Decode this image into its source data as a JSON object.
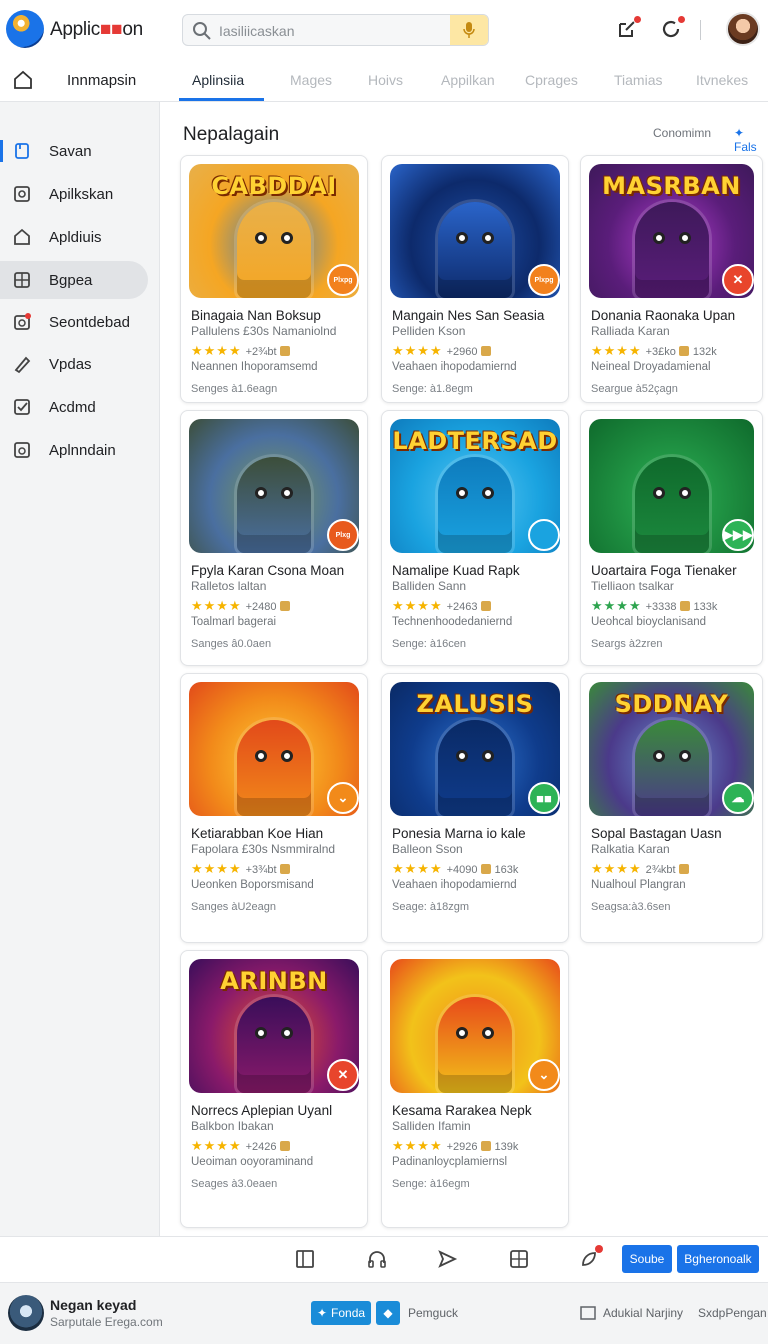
{
  "header": {
    "app_title_pre": "Applic",
    "app_title_red": "■■",
    "app_title_post": "on",
    "search_placeholder": "Iasiliicaskan"
  },
  "tabs": {
    "home_label": "Innmapsin",
    "items": [
      "Aplinsiia",
      "Mages",
      "Hoivs",
      "Appilkan",
      "Cprages",
      "Tiamias",
      "Itvnekes"
    ],
    "active_index": 0
  },
  "sidebar": {
    "items": [
      {
        "label": "Savan",
        "icon": "bookmark-icon"
      },
      {
        "label": "Apilkskan",
        "icon": "app-icon"
      },
      {
        "label": "Apldiuis",
        "icon": "home-icon"
      },
      {
        "label": "Bgpea",
        "icon": "grid-icon"
      },
      {
        "label": "Seontdebad",
        "icon": "downloads-icon"
      },
      {
        "label": "Vpdas",
        "icon": "pencil-icon"
      },
      {
        "label": "Acdmd",
        "icon": "check-icon"
      },
      {
        "label": "Aplnndain",
        "icon": "library-icon"
      }
    ],
    "active_index": 3
  },
  "content": {
    "title": "Nepalagain",
    "link_more": "Conomimn",
    "link_filter": "✦ Fals"
  },
  "cards": [
    {
      "art": "CABDDAI",
      "title": "Binagaia Nan Boksup",
      "sub": "Pallulens £30s Namaniolnd",
      "stars": "★★★★",
      "rating": "+2¾bt",
      "extra": "",
      "desc": "Neannen Ihoporamsemd",
      "foot": "Senges à1.6eagn",
      "badge": "Plxpg",
      "colors": [
        "#f5a623",
        "#3d7ab8",
        "#e8b04a"
      ],
      "badge_color": "#f2811d"
    },
    {
      "art": "",
      "title": "Mangain Nes San Seasia",
      "sub": "Pelliden Kson",
      "stars": "★★★★",
      "rating": "+2960",
      "extra": "",
      "desc": "Veahaen ihopodamiernd",
      "foot": "Senge: à1.8egm",
      "badge": "Plxpg",
      "colors": [
        "#0d2a6b",
        "#1e4fa8",
        "#2a64c9"
      ],
      "badge_color": "#f2811d"
    },
    {
      "art": "MASRBAN",
      "title": "Donania Raonaka Upan",
      "sub": "Ralliada Karan",
      "stars": "★★★★",
      "rating": "+3£ko",
      "extra": "132k",
      "desc": "Neineal Droyadamienal",
      "foot": "Seargue à52çagn",
      "badge": "✕",
      "colors": [
        "#5a1d7a",
        "#b33fd0",
        "#3e195a"
      ],
      "badge_color": "#e8452c"
    },
    {
      "art": "",
      "title": "Fpyla Karan Csona Moan",
      "sub": "Ralletos laltan",
      "stars": "★★★★",
      "rating": "+2480",
      "extra": "",
      "desc": "Toalmarl bagerai",
      "foot": "Sanges â0.0aen",
      "badge": "Plxg",
      "colors": [
        "#4a6fa0",
        "#7a9a5a",
        "#3c4e3a"
      ],
      "badge_color": "#e85a1d"
    },
    {
      "art": "LADTERSAD",
      "title": "Namalipe Kuad Rapk",
      "sub": "Balliden Sann",
      "stars": "★★★★",
      "rating": "+2463",
      "extra": "",
      "desc": "Technenhoodedaniernd",
      "foot": "Senge: à16cen",
      "badge": "",
      "colors": [
        "#1aa3e0",
        "#58c6f2",
        "#0e7bbd"
      ],
      "badge_color": "#1aa3e0"
    },
    {
      "art": "",
      "title": "Uoartaira Foga Tienaker",
      "sub": "Tielliaon tsalkar",
      "stars": "★★★★",
      "rating": "+3338",
      "extra": "133k",
      "desc": "Ueohcal bioyclanisand",
      "foot": "Seargs à2zren",
      "badge": "▶▶▶",
      "colors": [
        "#1c8a3e",
        "#2db356",
        "#0f6a2c"
      ],
      "badge_color": "#2db356",
      "green": true
    },
    {
      "art": "",
      "title": "Ketiarabban Koe Hian",
      "sub": "Fapolara £30s Nsmmiralnd",
      "stars": "★★★★",
      "rating": "+3¾bt",
      "extra": "",
      "desc": "Ueonken Boporsmisand",
      "foot": "Sanges àU2eagn",
      "badge": "⌄",
      "colors": [
        "#f28a1a",
        "#ffcc33",
        "#e24a1a"
      ],
      "badge_color": "#f28a1a"
    },
    {
      "art": "ZALUSIS",
      "title": "Ponesia Marna io kale",
      "sub": "Balleon Sson",
      "stars": "★★★★",
      "rating": "+4090",
      "extra": "163k",
      "desc": "Veahaen ihopodamiernd",
      "foot": "Seage: à18zgm",
      "badge": "■■",
      "colors": [
        "#0f3c8c",
        "#2f74d0",
        "#0a2a66"
      ],
      "badge_color": "#2db356"
    },
    {
      "art": "SDDNAY",
      "title": "Sopal Bastagan Uasn",
      "sub": "Ralkatia Karan",
      "stars": "★★★★",
      "rating": "2¾kbt",
      "extra": "",
      "desc": "Nualhoul Plangran",
      "foot": "Seagsa:à3.6sen",
      "badge": "☁",
      "colors": [
        "#4b3a8a",
        "#6a8fd0",
        "#3a8a3a"
      ],
      "badge_color": "#2db356"
    },
    {
      "art": "ARINBN",
      "title": "Norrecs Aplepian Uyanl",
      "sub": "Balkbon Ibakan",
      "stars": "★★★★",
      "rating": "+2426",
      "extra": "",
      "desc": "Ueoiman ooyoraminand",
      "foot": "Seages à3.0eaen",
      "badge": "✕",
      "colors": [
        "#8a1a6a",
        "#e8552c",
        "#3a0e5a"
      ],
      "badge_color": "#e8452c"
    },
    {
      "art": "",
      "title": "Kesama Rarakea Nepk",
      "sub": "Salliden Ifamin",
      "stars": "★★★★",
      "rating": "+2926",
      "extra": "139k",
      "desc": "Padinanloycplamiernsl",
      "foot": "Senge: à16egm",
      "badge": "⌄",
      "colors": [
        "#f2c21a",
        "#f28a1a",
        "#e84a1a"
      ],
      "badge_color": "#f28a1a"
    }
  ],
  "bottom_toolbar": {
    "btn1": "Soube",
    "btn2": "Bgheronoalk"
  },
  "footer": {
    "name": "Negan keyad",
    "sub": "Sarputale Erega.com",
    "btn_label": "Fonda",
    "link1": "Pemguck",
    "link2": "Adukial Narjiny",
    "link3": "SxdpPengan"
  }
}
